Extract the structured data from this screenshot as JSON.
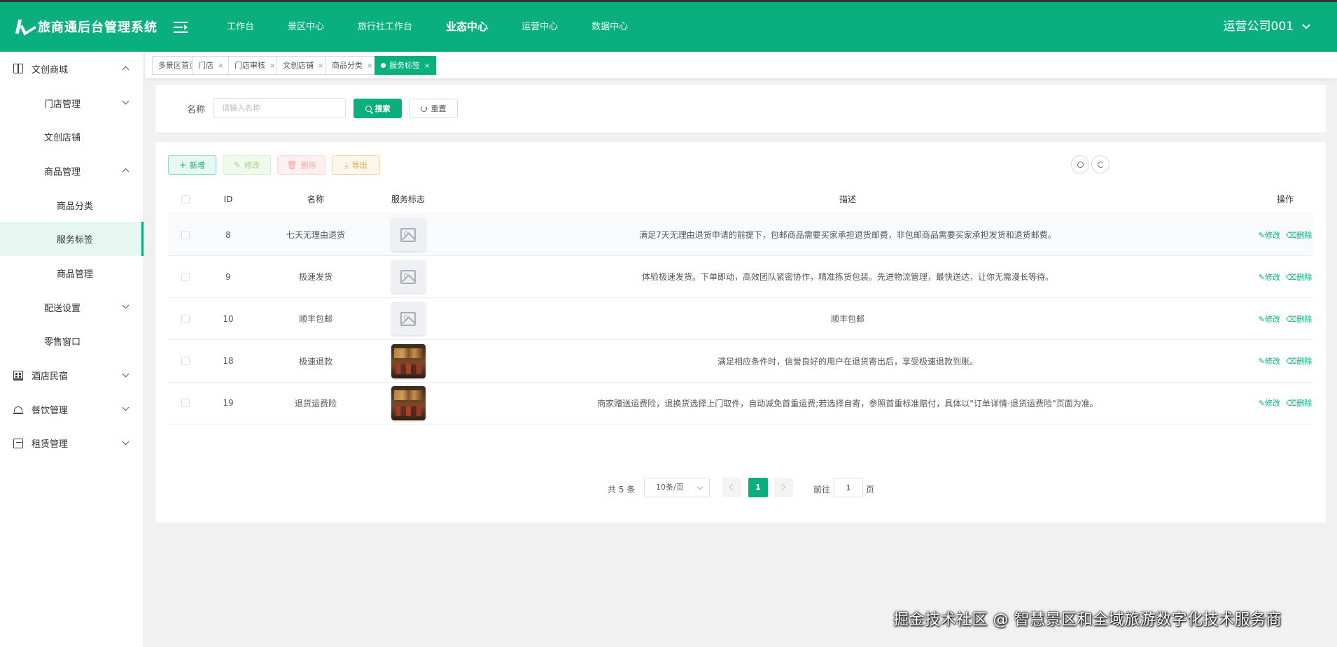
{
  "header": {
    "logo_text": "旅商通后台管理系统",
    "nav": [
      "工作台",
      "景区中心",
      "旅行社工作台",
      "业态中心",
      "运营中心",
      "数据中心"
    ],
    "active_nav": "业态中心",
    "user": "运营公司001"
  },
  "sidebar": {
    "items": [
      {
        "label": "文创商城",
        "level": 1,
        "icon": "book-icon",
        "caret": "up"
      },
      {
        "label": "门店管理",
        "level": 2,
        "caret": "down"
      },
      {
        "label": "文创店铺",
        "level": 2
      },
      {
        "label": "商品管理",
        "level": 2,
        "caret": "up"
      },
      {
        "label": "商品分类",
        "level": 3
      },
      {
        "label": "服务标签",
        "level": 3,
        "selected": true
      },
      {
        "label": "商品管理",
        "level": 3
      },
      {
        "label": "配送设置",
        "level": 2,
        "caret": "down"
      },
      {
        "label": "零售窗口",
        "level": 2
      },
      {
        "label": "酒店民宿",
        "level": 1,
        "icon": "hotel-icon",
        "caret": "down"
      },
      {
        "label": "餐饮管理",
        "level": 1,
        "icon": "food-icon",
        "caret": "down"
      },
      {
        "label": "租赁管理",
        "level": 1,
        "icon": "rent-icon",
        "caret": "down"
      }
    ]
  },
  "tabs": [
    {
      "label": "多景区首页",
      "closable": false
    },
    {
      "label": "门店",
      "closable": true
    },
    {
      "label": "门店审核",
      "closable": true
    },
    {
      "label": "文创店铺",
      "closable": true
    },
    {
      "label": "商品分类",
      "closable": true
    },
    {
      "label": "服务标签",
      "closable": true,
      "active": true
    }
  ],
  "search": {
    "label": "名称",
    "placeholder": "请输入名称",
    "value": "",
    "search_label": "搜索",
    "reset_label": "重置"
  },
  "toolbar": {
    "add": "新增",
    "edit": "修改",
    "delete": "删除",
    "export": "导出"
  },
  "table": {
    "columns": [
      "ID",
      "名称",
      "服务标志",
      "描述",
      "操作"
    ],
    "rows": [
      {
        "id": "8",
        "name": "七天无理由退货",
        "logo": "placeholder",
        "desc": "满足7天无理由退货申请的前提下，包邮商品需要买家承担退货邮费，非包邮商品需要买家承担发货和退货邮费。"
      },
      {
        "id": "9",
        "name": "极速发货",
        "logo": "placeholder",
        "desc": "体验极速发货。下单即动，高效团队紧密协作，精准拣货包装。先进物流管理，最快送达，让你无需漫长等待。"
      },
      {
        "id": "10",
        "name": "顺丰包邮",
        "logo": "placeholder",
        "desc": "顺丰包邮"
      },
      {
        "id": "18",
        "name": "极速退款",
        "logo": "photo",
        "desc": "满足相应条件时，信誉良好的用户在退货寄出后，享受极速退款到账。"
      },
      {
        "id": "19",
        "name": "退货运费险",
        "logo": "photo",
        "desc": "商家赠送运费险，退换货选择上门取件，自动减免首重运费;若选择自寄，参照首重标准赔付，具体以\"订单详情-退货运费险\"页面为准。"
      }
    ],
    "op_edit": "修改",
    "op_delete": "删除"
  },
  "pagination": {
    "total": "共 5 条",
    "page_size": "10条/页",
    "current": "1",
    "goto_label": "前往",
    "goto_value": "1",
    "page_unit": "页"
  },
  "watermark": "掘金技术社区 @ 智慧景区和全域旅游数字化技术服务商",
  "colors": {
    "primary": "#0aaf7e",
    "sidebar_selected_bg": "#e6f6f0",
    "page_bg": "#f1f1f1"
  }
}
